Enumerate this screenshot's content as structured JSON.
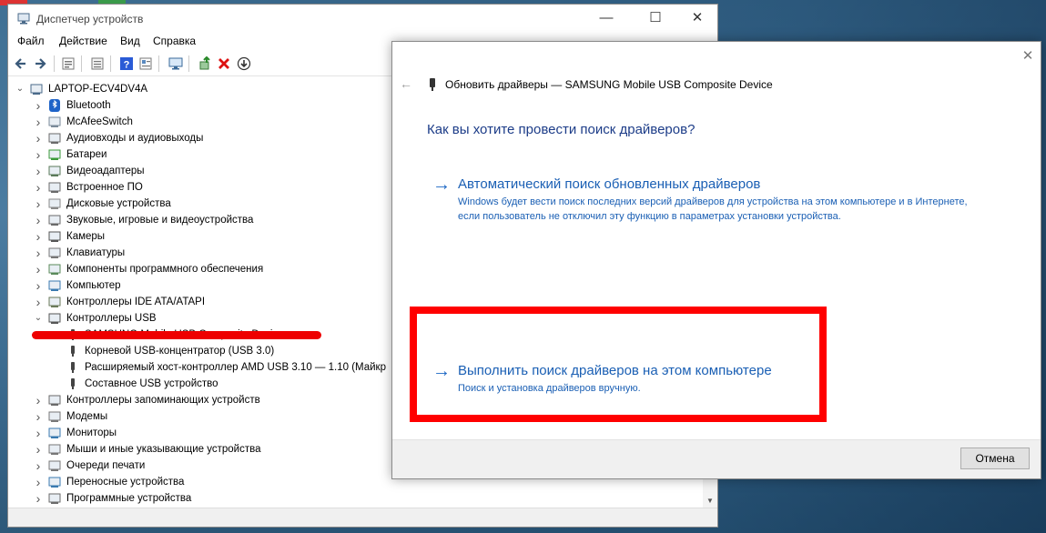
{
  "device_manager": {
    "title": "Диспетчер устройств",
    "menu": [
      "Файл",
      "Действие",
      "Вид",
      "Справка"
    ],
    "toolbar_icons": [
      "back-icon",
      "forward-icon",
      "show-hidden-icon",
      "properties-icon",
      "help-icon",
      "view-icon",
      "scan-hardware-icon",
      "update-driver-icon",
      "uninstall-icon",
      "download-icon"
    ],
    "tree": [
      {
        "label": "LAPTOP-ECV4DV4A",
        "level": 0,
        "expander": "expanded",
        "icon": "computer-icon"
      },
      {
        "label": "Bluetooth",
        "level": 1,
        "expander": "collapsed",
        "icon": "bluetooth-icon"
      },
      {
        "label": "McAfeeSwitch",
        "level": 1,
        "expander": "collapsed",
        "icon": "network-icon"
      },
      {
        "label": "Аудиовходы и аудиовыходы",
        "level": 1,
        "expander": "collapsed",
        "icon": "audio-icon"
      },
      {
        "label": "Батареи",
        "level": 1,
        "expander": "collapsed",
        "icon": "battery-icon"
      },
      {
        "label": "Видеоадаптеры",
        "level": 1,
        "expander": "collapsed",
        "icon": "display-adapter-icon"
      },
      {
        "label": "Встроенное ПО",
        "level": 1,
        "expander": "collapsed",
        "icon": "firmware-icon"
      },
      {
        "label": "Дисковые устройства",
        "level": 1,
        "expander": "collapsed",
        "icon": "disk-icon"
      },
      {
        "label": "Звуковые, игровые и видеоустройства",
        "level": 1,
        "expander": "collapsed",
        "icon": "speaker-icon"
      },
      {
        "label": "Камеры",
        "level": 1,
        "expander": "collapsed",
        "icon": "camera-icon"
      },
      {
        "label": "Клавиатуры",
        "level": 1,
        "expander": "collapsed",
        "icon": "keyboard-icon"
      },
      {
        "label": "Компоненты программного обеспечения",
        "level": 1,
        "expander": "collapsed",
        "icon": "software-component-icon"
      },
      {
        "label": "Компьютер",
        "level": 1,
        "expander": "collapsed",
        "icon": "monitor-icon"
      },
      {
        "label": "Контроллеры IDE ATA/ATAPI",
        "level": 1,
        "expander": "collapsed",
        "icon": "ide-controller-icon"
      },
      {
        "label": "Контроллеры USB",
        "level": 1,
        "expander": "expanded",
        "icon": "usb-icon"
      },
      {
        "label": "SAMSUNG Mobile USB Composite Device",
        "level": 2,
        "expander": "none",
        "icon": "usb-plug-icon"
      },
      {
        "label": "Корневой USB-концентратор (USB 3.0)",
        "level": 2,
        "expander": "none",
        "icon": "usb-plug-icon"
      },
      {
        "label": "Расширяемый хост-контроллер AMD USB 3.10 — 1.10 (Майкр",
        "level": 2,
        "expander": "none",
        "icon": "usb-plug-icon"
      },
      {
        "label": "Составное USB устройство",
        "level": 2,
        "expander": "none",
        "icon": "usb-plug-icon"
      },
      {
        "label": "Контроллеры запоминающих устройств",
        "level": 1,
        "expander": "collapsed",
        "icon": "storage-controller-icon"
      },
      {
        "label": "Модемы",
        "level": 1,
        "expander": "collapsed",
        "icon": "modem-icon"
      },
      {
        "label": "Мониторы",
        "level": 1,
        "expander": "collapsed",
        "icon": "monitor-icon"
      },
      {
        "label": "Мыши и иные указывающие устройства",
        "level": 1,
        "expander": "collapsed",
        "icon": "mouse-icon"
      },
      {
        "label": "Очереди печати",
        "level": 1,
        "expander": "collapsed",
        "icon": "printer-icon"
      },
      {
        "label": "Переносные устройства",
        "level": 1,
        "expander": "collapsed",
        "icon": "portable-device-icon"
      },
      {
        "label": "Программные устройства",
        "level": 1,
        "expander": "collapsed",
        "icon": "software-device-icon"
      }
    ]
  },
  "wizard": {
    "header_title": "Обновить драйверы — SAMSUNG Mobile USB Composite Device",
    "question": "Как вы хотите провести поиск драйверов?",
    "options": [
      {
        "title": "Автоматический поиск обновленных драйверов",
        "description": "Windows будет вести поиск последних версий драйверов для устройства на этом компьютере и в Интернете, если пользователь не отключил эту функцию в параметрах установки устройства."
      },
      {
        "title": "Выполнить поиск драйверов на этом компьютере",
        "description": "Поиск и установка драйверов вручную."
      }
    ],
    "cancel_label": "Отмена"
  },
  "colors": {
    "link_blue": "#1a5fb4",
    "question_blue": "#1c3c88",
    "highlight_red": "#ff0000"
  }
}
